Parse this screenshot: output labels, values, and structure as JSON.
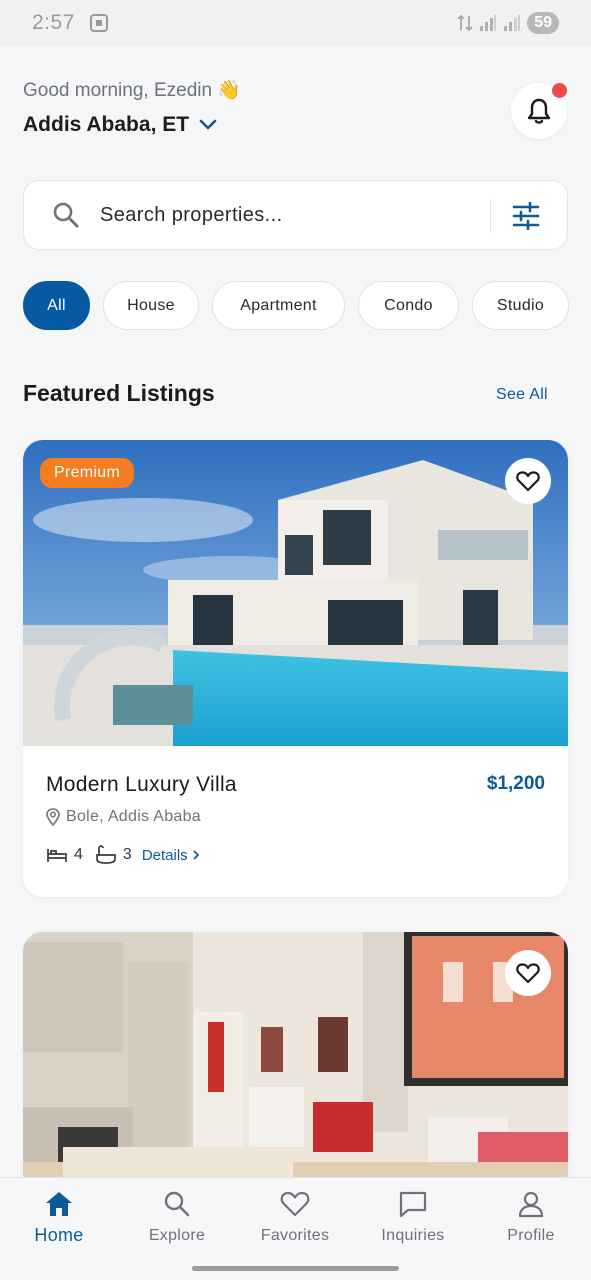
{
  "status_bar": {
    "time": "2:57",
    "battery": "59"
  },
  "header": {
    "greeting": "Good morning, Ezedin 👋",
    "location": "Addis Ababa, ET"
  },
  "search": {
    "placeholder": "Search properties..."
  },
  "categories": [
    "All",
    "House",
    "Apartment",
    "Condo",
    "Studio"
  ],
  "featured": {
    "title": "Featured Listings",
    "see_all": "See All"
  },
  "listings": [
    {
      "badge": "Premium",
      "title": "Modern Luxury Villa",
      "price": "$1,200",
      "location": "Bole, Addis Ababa",
      "beds": "4",
      "baths": "3",
      "details": "Details"
    },
    {
      "badge": "",
      "title": "",
      "price": "",
      "location": ""
    }
  ],
  "nav": {
    "items": [
      {
        "label": "Home",
        "icon": "home-icon"
      },
      {
        "label": "Explore",
        "icon": "search-icon"
      },
      {
        "label": "Favorites",
        "icon": "heart-icon"
      },
      {
        "label": "Inquiries",
        "icon": "message-icon"
      },
      {
        "label": "Profile",
        "icon": "user-icon"
      }
    ]
  },
  "colors": {
    "accent": "#055aa3",
    "badge": "#f57c21",
    "notification_dot": "#f0484a"
  }
}
